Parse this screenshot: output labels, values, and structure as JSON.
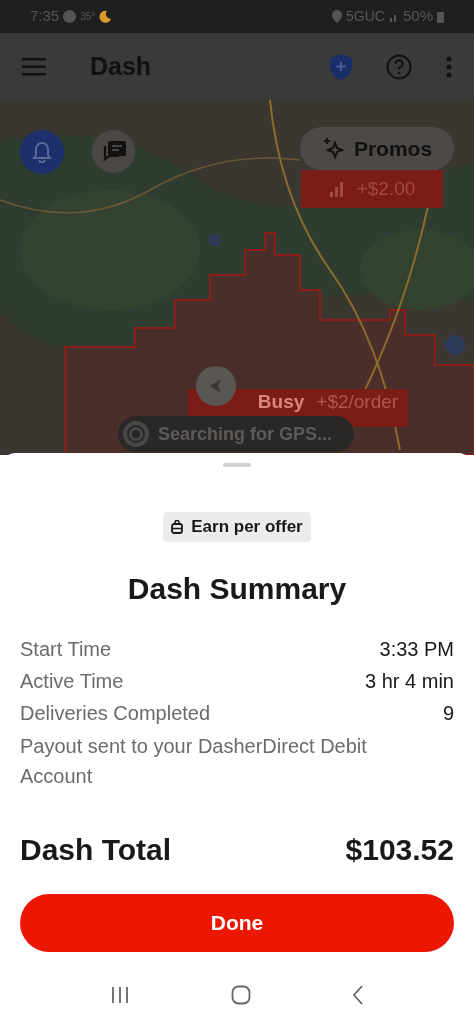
{
  "status_bar": {
    "time": "7:35",
    "temperature": "35°",
    "network": "5GUC",
    "battery": "50%"
  },
  "app_bar": {
    "title": "Dash"
  },
  "map": {
    "promos_button": "Promos",
    "promo_tag": "+$2.00",
    "busy_tag": {
      "label": "Busy",
      "bonus": "+$2/order"
    },
    "gps_status": "Searching for GPS..."
  },
  "summary": {
    "badge": "Earn per offer",
    "title": "Dash Summary",
    "rows": [
      {
        "label": "Start Time",
        "value": "3:33 PM"
      },
      {
        "label": "Active Time",
        "value": "3 hr 4 min"
      },
      {
        "label": "Deliveries Completed",
        "value": "9"
      }
    ],
    "note": "Payout sent to your DasherDirect Debit Account",
    "total_label": "Dash Total",
    "total": "$103.52",
    "done_button": "Done"
  }
}
